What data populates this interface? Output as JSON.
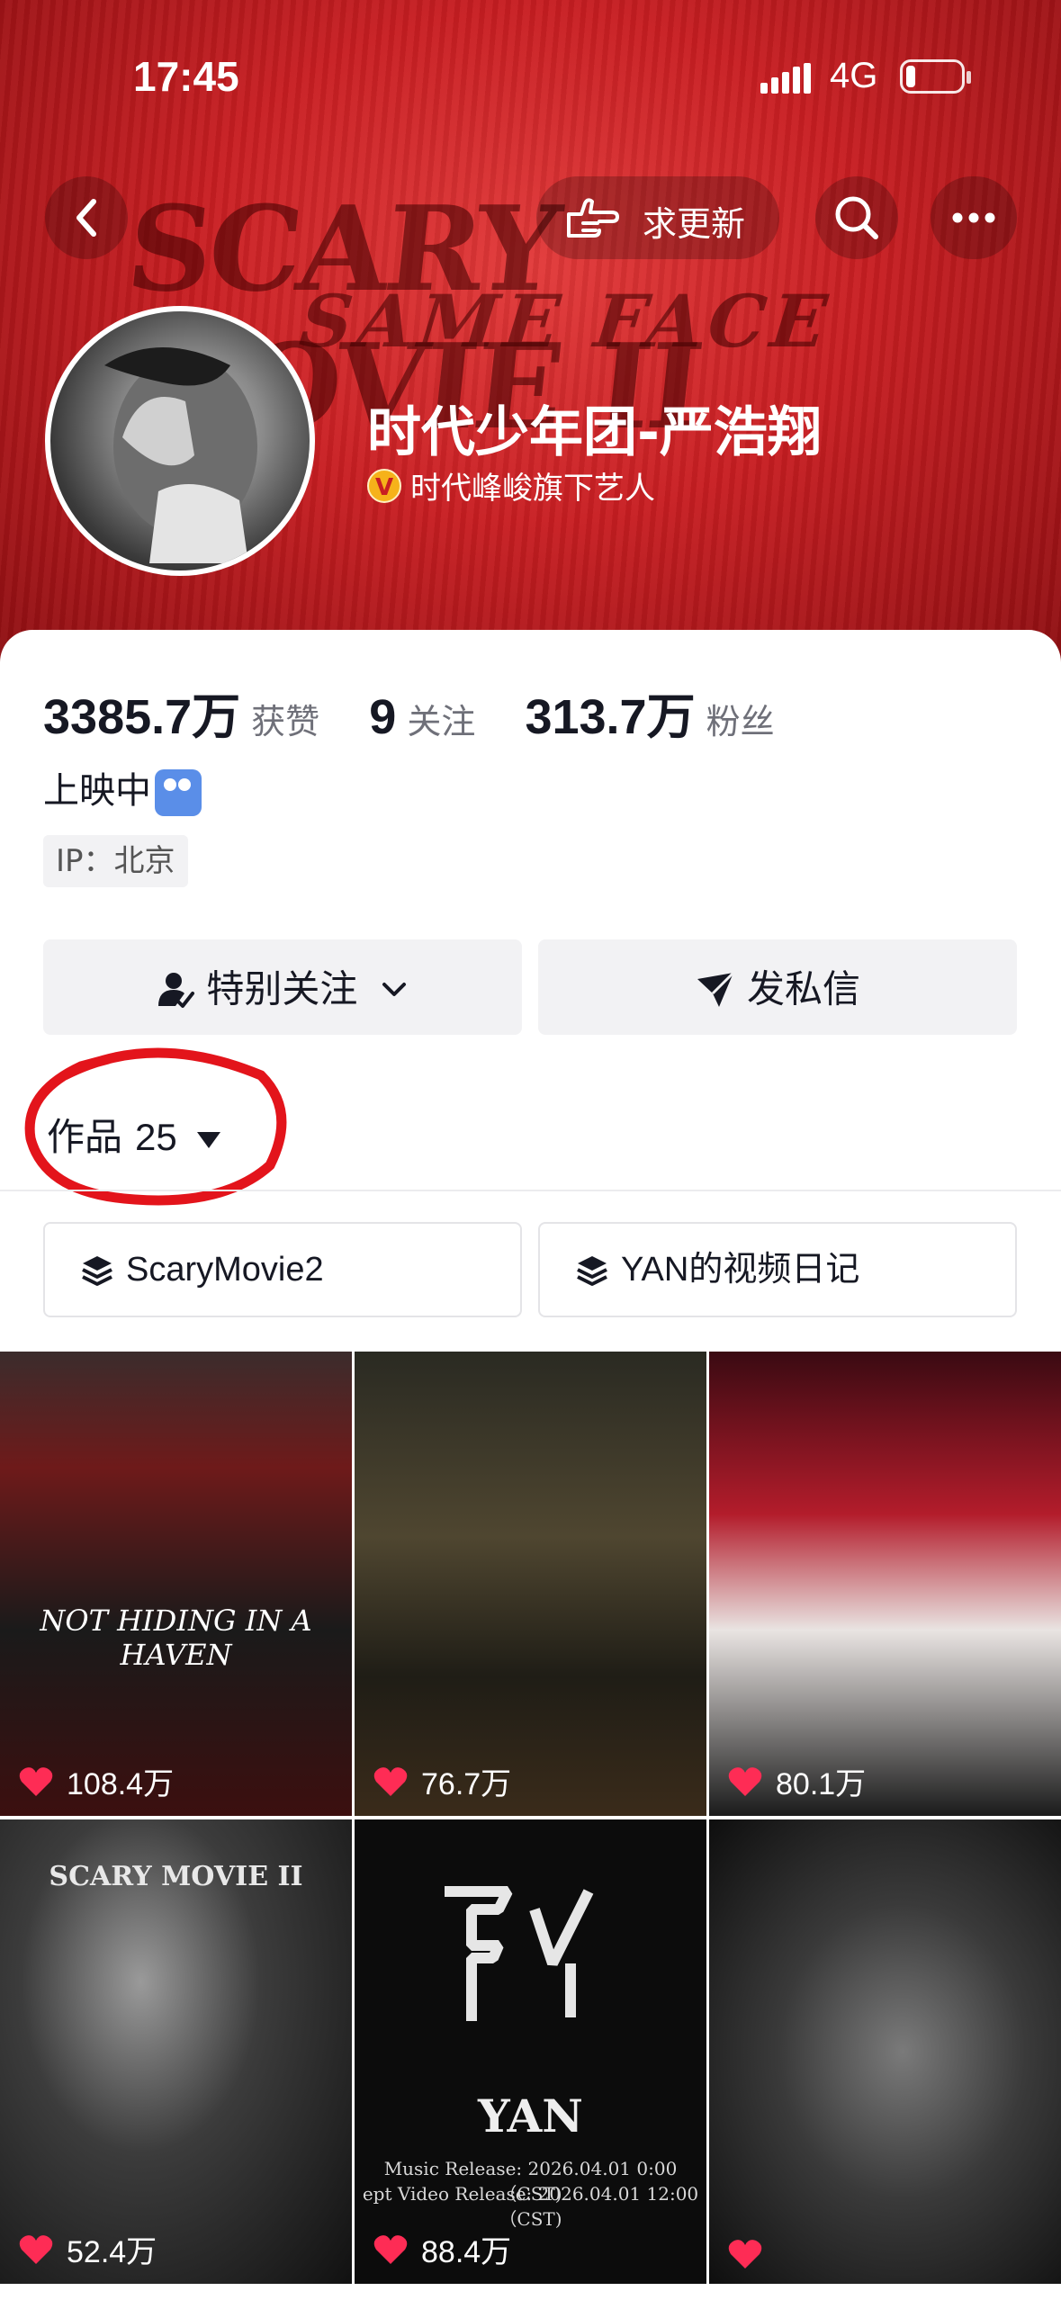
{
  "status_bar": {
    "time": "17:45",
    "network": "4G"
  },
  "header": {
    "update_label": "求更新",
    "banner_art_line1": "SCARY MOVIE II",
    "banner_art_line2": "SAME FACE"
  },
  "profile": {
    "name": "时代少年团-严浩翔",
    "verification": "时代峰峻旗下艺人",
    "verify_badge": "V",
    "stats": [
      {
        "value": "3385.7万",
        "label": "获赞"
      },
      {
        "value": "9",
        "label": "关注"
      },
      {
        "value": "313.7万",
        "label": "粉丝"
      }
    ],
    "bio": "上映中",
    "ip": "IP：北京"
  },
  "actions": {
    "follow_label": "特别关注",
    "message_label": "发私信"
  },
  "works": {
    "label": "作品",
    "count": "25"
  },
  "collections": [
    {
      "label": "ScaryMovie2"
    },
    {
      "label": "YAN的视频日记"
    }
  ],
  "videos": [
    {
      "likes": "108.4万",
      "overlay": "NOT HIDING IN A HAVEN"
    },
    {
      "likes": "76.7万"
    },
    {
      "likes": "80.1万"
    },
    {
      "likes": "52.4万",
      "overlay": "SCARY MOVIE II"
    },
    {
      "likes": "88.4万",
      "title": "YAN",
      "line1": "Music Release: 2026.04.01 0:00（CST)",
      "line2": "ept Video Release: 2026.04.01 12:00（CST)"
    },
    {
      "likes": ""
    }
  ],
  "colors": {
    "banner": "#c81e22",
    "like_heart": "#fe2c55",
    "annotation_circle": "#e3141b"
  }
}
